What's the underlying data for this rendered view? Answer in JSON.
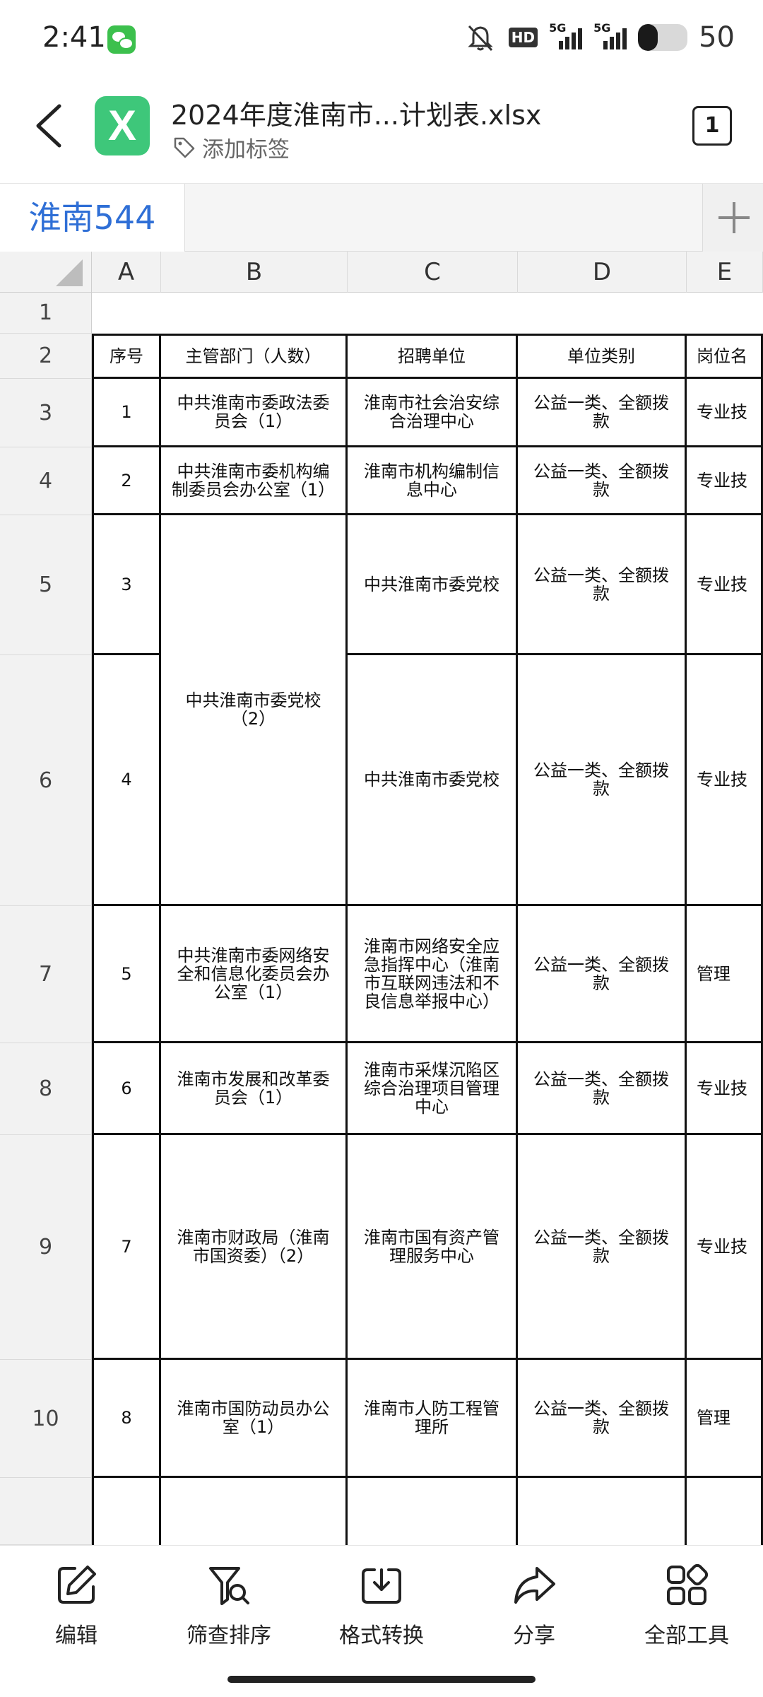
{
  "status_bar": {
    "time": "2:41",
    "network_1": "5G",
    "network_2": "5G",
    "hd_badge": "HD",
    "battery": "50",
    "battery_fraction": 0.4,
    "icons": [
      "wechat-icon",
      "mute-icon",
      "signal-icon",
      "battery-icon"
    ]
  },
  "header": {
    "file_name": "2024年度淮南市...计划表.xlsx",
    "app_icon_letter": "X",
    "app_icon_color": "#3ec77a",
    "add_tag_label": "添加标签",
    "sheet_count": "1"
  },
  "sheet_tab": {
    "active_label": "淮南544",
    "accent_color": "#2f6fd6"
  },
  "grid": {
    "column_headers": [
      "A",
      "B",
      "C",
      "D",
      "E"
    ],
    "row_numbers": [
      "1",
      "2",
      "3",
      "4",
      "5",
      "6",
      "7",
      "8",
      "9",
      "10"
    ],
    "table_headers": {
      "serial": "序号",
      "department": "主管部门（人数）",
      "unit": "招聘单位",
      "unit_type": "单位类别",
      "position": "岗位名"
    },
    "rows": [
      {
        "serial": "1",
        "department": "中共淮南市委政法委员会（1）",
        "unit": "淮南市社会治安综合治理中心",
        "unit_type": "公益一类、全额拨款",
        "position": "专业技"
      },
      {
        "serial": "2",
        "department": "中共淮南市委机构编制委员会办公室（1）",
        "unit": "淮南市机构编制信息中心",
        "unit_type": "公益一类、全额拨款",
        "position": "专业技"
      },
      {
        "serial": "3",
        "department": "中共淮南市委党校（2）",
        "unit": "中共淮南市委党校",
        "unit_type": "公益一类、全额拨款",
        "position": "专业技"
      },
      {
        "serial": "4",
        "department": "",
        "unit": "中共淮南市委党校",
        "unit_type": "公益一类、全额拨款",
        "position": "专业技"
      },
      {
        "serial": "5",
        "department": "中共淮南市委网络安全和信息化委员会办公室（1）",
        "unit": "淮南市网络安全应急指挥中心（淮南市互联网违法和不良信息举报中心）",
        "unit_type": "公益一类、全额拨款",
        "position": "管理"
      },
      {
        "serial": "6",
        "department": "淮南市发展和改革委员会（1）",
        "unit": "淮南市采煤沉陷区综合治理项目管理中心",
        "unit_type": "公益一类、全额拨款",
        "position": "专业技"
      },
      {
        "serial": "7",
        "department": "淮南市财政局（淮南市国资委）（2）",
        "unit": "淮南市国有资产管理服务中心",
        "unit_type": "公益一类、全额拨款",
        "position": "专业技"
      },
      {
        "serial": "8",
        "department": "淮南市国防动员办公室（1）",
        "unit": "淮南市人防工程管理所",
        "unit_type": "公益一类、全额拨款",
        "position": "管理"
      }
    ]
  },
  "toolbar": {
    "edit": "编辑",
    "filter_sort": "筛查排序",
    "format_convert": "格式转换",
    "share": "分享",
    "all_tools": "全部工具"
  }
}
